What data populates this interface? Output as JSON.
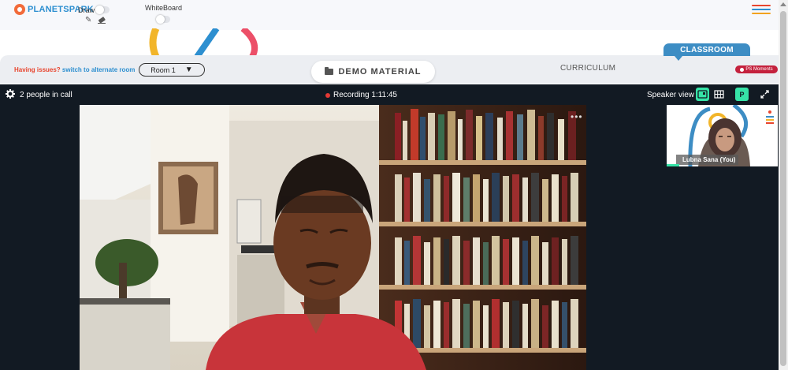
{
  "topbar": {
    "logo": {
      "part1": "PLANET",
      "part2": "SPARK",
      "icon": "planetspark-logo"
    },
    "draw_label": "Draw",
    "whiteboard_label": "WhiteBoard",
    "tools": [
      "pencil-icon",
      "eraser-icon"
    ],
    "menu_icon": "hamburger-icon"
  },
  "issue": {
    "text": "Having issues?",
    "link": "switch to alternate room"
  },
  "room_select": {
    "value": "Room 1"
  },
  "demo_button": {
    "label": "DEMO MATERIAL",
    "icon": "folder-icon"
  },
  "tabs": {
    "curriculum": "CURRICULUM",
    "classroom": "CLASSROOM"
  },
  "moments_badge": {
    "label": "PS Moments"
  },
  "call": {
    "people_count": "2 people in call",
    "recording": "Recording 1:11:45",
    "speaker_view_label": "Speaker view",
    "participant_initial": "P",
    "self_name": "Lubna Sana (You)",
    "more_options": "•••"
  },
  "colors": {
    "brand_red": "#e8452e",
    "brand_blue": "#2d8fd0",
    "classroom_tab": "#3d8dc4",
    "moments": "#c4213d",
    "call_bg": "#121a23",
    "active_green": "#36e3a7",
    "recording_dot": "#e53935"
  }
}
